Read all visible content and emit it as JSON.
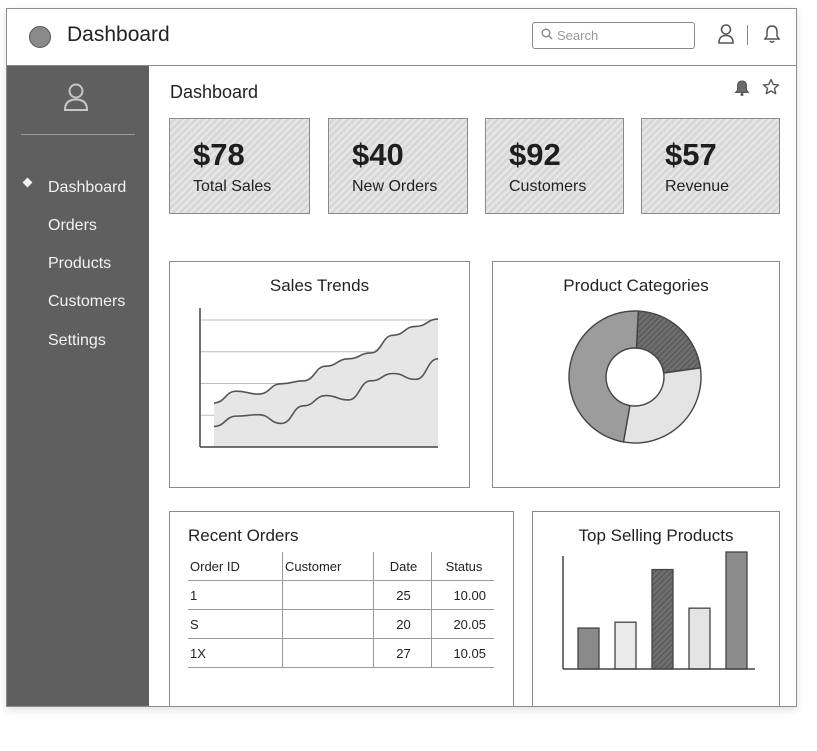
{
  "app": {
    "title": "Dashboard"
  },
  "search": {
    "placeholder": "Search"
  },
  "sidebar": {
    "items": [
      {
        "label": "Dashboard",
        "active": true
      },
      {
        "label": "Orders"
      },
      {
        "label": "Products"
      },
      {
        "label": "Customers"
      },
      {
        "label": "Settings"
      }
    ]
  },
  "main": {
    "title": "Dashboard"
  },
  "stats": [
    {
      "value": "$78",
      "label": "Total Sales"
    },
    {
      "value": "$40",
      "label": "New Orders"
    },
    {
      "value": "$92",
      "label": "Customers"
    },
    {
      "value": "$57",
      "label": "Revenue"
    }
  ],
  "panels": {
    "sales_trends": "Sales Trends",
    "product_categories": "Product Categories",
    "recent_orders": "Recent Orders",
    "top_selling": "Top Selling Products"
  },
  "orders": {
    "columns": [
      "Order ID",
      "Customer",
      "Date",
      "Status"
    ],
    "rows": [
      {
        "id": "1",
        "customer": "",
        "date": "25",
        "status": "10.00"
      },
      {
        "id": "S",
        "customer": "",
        "date": "20",
        "status": "20.05"
      },
      {
        "id": "1X",
        "customer": "",
        "date": "27",
        "status": "10.05"
      }
    ]
  },
  "colors": {
    "sidebar": "#5f5f5f",
    "card": "#dcdcdc",
    "border": "#8a8a8a"
  },
  "chart_data": [
    {
      "type": "area",
      "title": "Sales Trends",
      "x": [
        0,
        1,
        2,
        3,
        4,
        5,
        6,
        7,
        8,
        9,
        10
      ],
      "series": [
        {
          "values": [
            30,
            38,
            36,
            43,
            45,
            55,
            60,
            64,
            76,
            82,
            87
          ]
        },
        {
          "values": [
            14,
            21,
            22,
            16,
            28,
            35,
            32,
            45,
            50,
            46,
            60
          ]
        }
      ],
      "ylim": [
        0,
        100
      ]
    },
    {
      "type": "pie",
      "title": "Product Categories",
      "values": [
        22,
        30,
        48
      ]
    },
    {
      "type": "bar",
      "title": "Top Selling Products",
      "values": [
        35,
        40,
        85,
        52,
        100
      ],
      "ylim": [
        0,
        100
      ]
    }
  ]
}
